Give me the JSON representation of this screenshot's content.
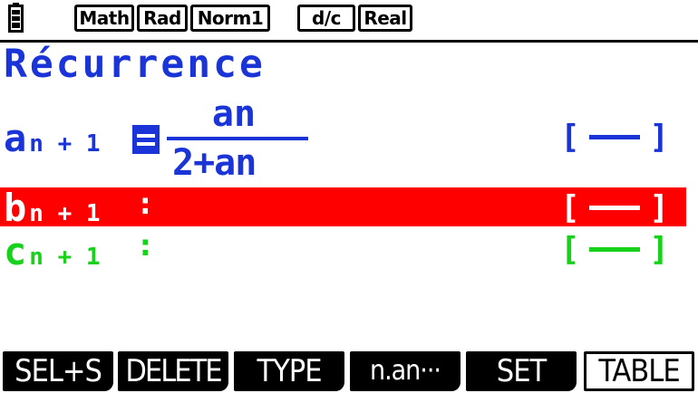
{
  "status": {
    "icon": "battery-icon",
    "indicators": [
      "Math",
      "Rad",
      "Norm1",
      "d/c",
      "Real"
    ]
  },
  "screen": {
    "title": "Récurrence"
  },
  "rows": [
    {
      "name": "a",
      "label_main": "a",
      "label_sub": "n + 1",
      "numerator": "an",
      "denominator": "2+an",
      "bracket_open": "[",
      "bracket_close": "]",
      "color": "#1a34d8"
    },
    {
      "name": "b",
      "label_main": "b",
      "label_sub": "n + 1",
      "colon": ":",
      "bracket_open": "[",
      "bracket_close": "]",
      "color": "#ffffff",
      "highlight": "#ff0000"
    },
    {
      "name": "c",
      "label_main": "c",
      "label_sub": "n + 1",
      "colon": ":",
      "bracket_open": "[",
      "bracket_close": "]",
      "color": "#17d21a"
    }
  ],
  "function_keys": [
    "SEL+S",
    "DELETE",
    "TYPE",
    "n.an···",
    "SET",
    "TABLE"
  ]
}
